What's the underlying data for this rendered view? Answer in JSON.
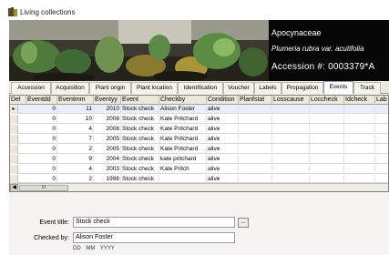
{
  "window": {
    "title": "Living collections"
  },
  "header": {
    "family": "Apocynaceae",
    "species": "Plumeria rubra var. acutifolia",
    "accession": "Accession #: 0003379*A"
  },
  "tabs": [
    {
      "label": "Accession",
      "active": false
    },
    {
      "label": "Acquisition",
      "active": false
    },
    {
      "label": "Plant origin",
      "active": false
    },
    {
      "label": "Plant location",
      "active": false
    },
    {
      "label": "Identification",
      "active": false
    },
    {
      "label": "Voucher",
      "active": false
    },
    {
      "label": "Labels",
      "active": false
    },
    {
      "label": "Propagation",
      "active": false
    },
    {
      "label": "Events",
      "active": true
    },
    {
      "label": "Track",
      "active": false
    }
  ],
  "grid": {
    "columns": [
      "Del",
      "Eventdd",
      "Eventmm",
      "Eventyy",
      "Event",
      "Checkby",
      "Condition",
      "Planfstat",
      "Losscause",
      "Loccheck",
      "Idcheck",
      "Lab"
    ],
    "rows": [
      {
        "del": "",
        "eventdd": "0",
        "eventmm": "11",
        "eventyy": "2010",
        "event": "Stock check",
        "checkby": "Alison Foster",
        "condition": "alive"
      },
      {
        "del": "",
        "eventdd": "0",
        "eventmm": "10",
        "eventyy": "2008",
        "event": "Stock check",
        "checkby": "Kate Pritchard",
        "condition": "alive"
      },
      {
        "del": "",
        "eventdd": "0",
        "eventmm": "4",
        "eventyy": "2008",
        "event": "Stock check",
        "checkby": "Kate Pritchard",
        "condition": "alive"
      },
      {
        "del": "",
        "eventdd": "0",
        "eventmm": "7",
        "eventyy": "2005",
        "event": "Stock check",
        "checkby": "Kate Pritchard",
        "condition": "alive"
      },
      {
        "del": "",
        "eventdd": "0",
        "eventmm": "2",
        "eventyy": "2005",
        "event": "Stock check",
        "checkby": "Kate Pritchard",
        "condition": "alive"
      },
      {
        "del": "",
        "eventdd": "0",
        "eventmm": "9",
        "eventyy": "2004",
        "event": "Stock check",
        "checkby": "kate pritchard",
        "condition": "alive"
      },
      {
        "del": "",
        "eventdd": "0",
        "eventmm": "4",
        "eventyy": "2003",
        "event": "Stock check",
        "checkby": "Kate Pritch",
        "condition": "alive"
      },
      {
        "del": "",
        "eventdd": "0",
        "eventmm": "2",
        "eventyy": "1998",
        "event": "Stock check",
        "checkby": "",
        "condition": "alive"
      }
    ],
    "selected_row": 0,
    "scroll_thumb": "III"
  },
  "form": {
    "event_title_label": "Event title:",
    "event_title_value": "Stock check",
    "browse_label": "...",
    "checked_by_label": "Checked by:",
    "checked_by_value": "Alison Foster",
    "date_hint": "DD MM YYYY"
  }
}
